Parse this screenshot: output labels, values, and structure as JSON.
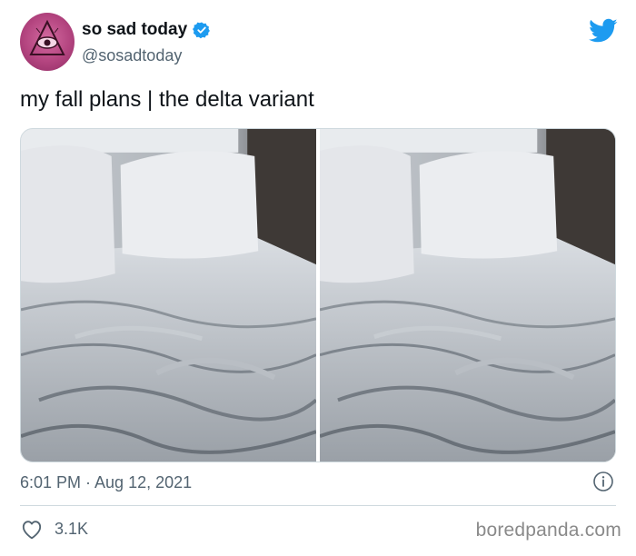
{
  "tweet": {
    "display_name": "so sad today",
    "handle": "@sosadtoday",
    "text": "my fall plans | the delta variant",
    "timestamp": "6:01 PM · Aug 12, 2021",
    "likes": "3.1K"
  },
  "images": [
    {
      "icon": "unmade-bed-photo"
    },
    {
      "icon": "unmade-bed-photo"
    }
  ],
  "icons": {
    "verified": "verified-badge-icon",
    "brand": "twitter-bird-icon",
    "info": "info-icon",
    "like": "heart-icon"
  },
  "colors": {
    "verified_blue": "#1d9bf0",
    "twitter_blue": "#1d9bf0",
    "secondary_text": "#536471",
    "avatar_pink": "#b3447f"
  },
  "watermark": "boredpanda.com"
}
